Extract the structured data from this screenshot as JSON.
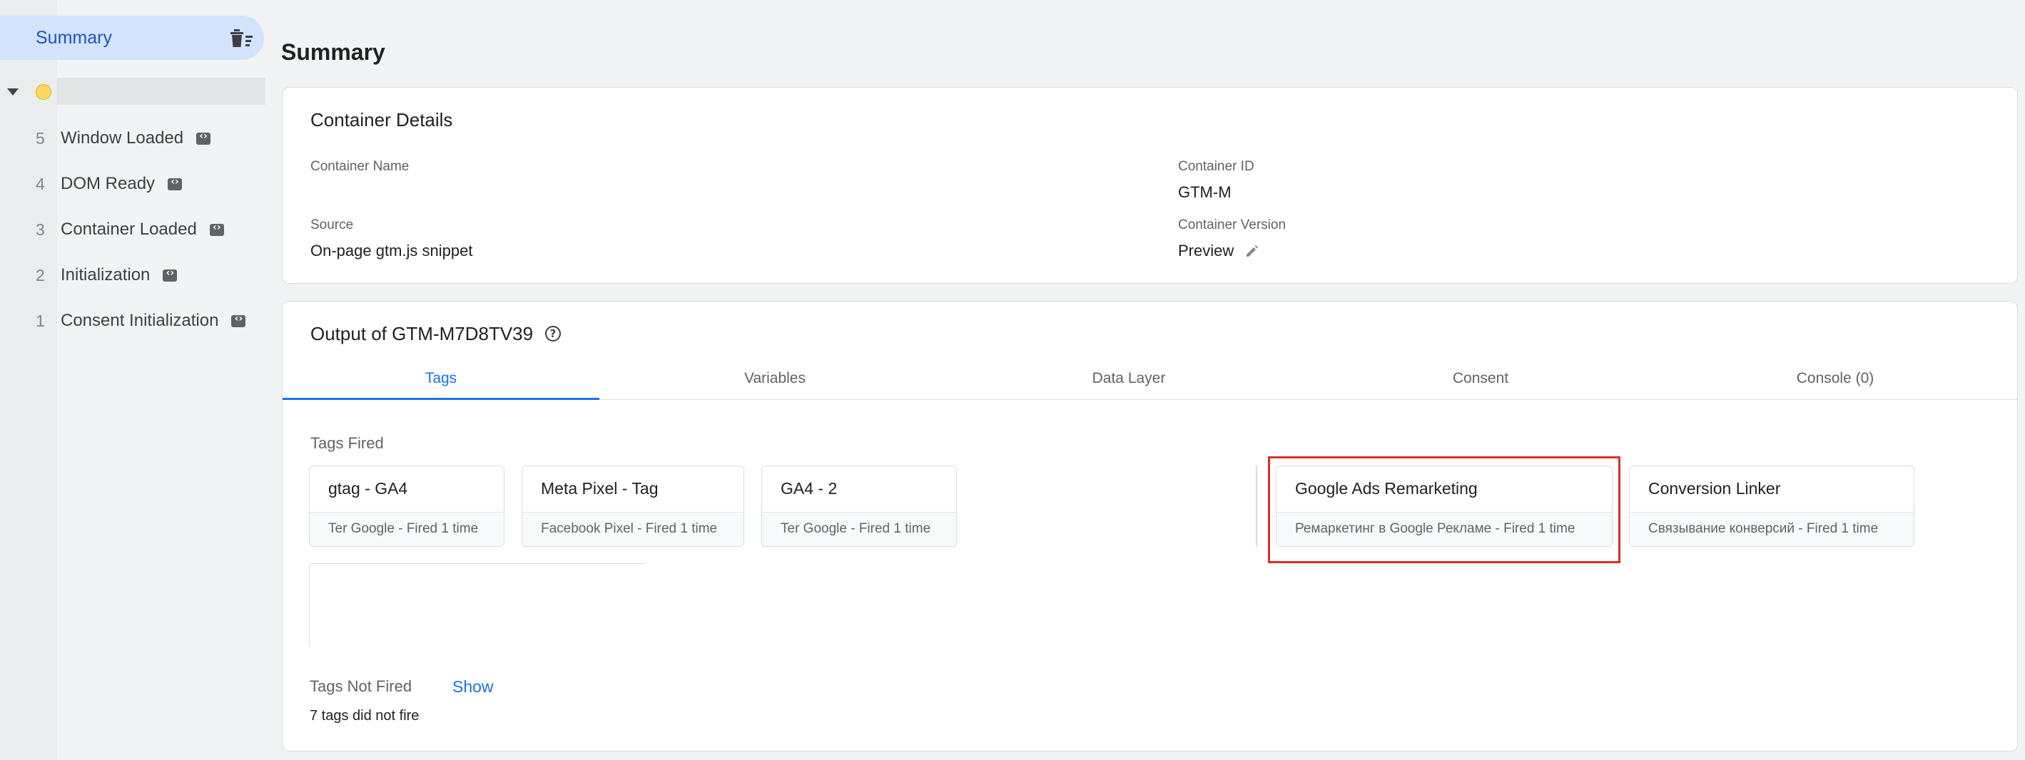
{
  "sidebar": {
    "summary_label": "Summary",
    "events": [
      {
        "num": "5",
        "label": "Window Loaded"
      },
      {
        "num": "4",
        "label": "DOM Ready"
      },
      {
        "num": "3",
        "label": "Container Loaded"
      },
      {
        "num": "2",
        "label": "Initialization"
      },
      {
        "num": "1",
        "label": "Consent Initialization"
      }
    ]
  },
  "main": {
    "title": "Summary",
    "container_details": {
      "title": "Container Details",
      "container_name_label": "Container Name",
      "container_name_value": "",
      "container_id_label": "Container ID",
      "container_id_value": "GTM-M",
      "source_label": "Source",
      "source_value": "On-page gtm.js snippet",
      "version_label": "Container Version",
      "version_value": "Preview"
    },
    "output": {
      "title": "Output of GTM-M7D8TV39",
      "tabs": [
        "Tags",
        "Variables",
        "Data Layer",
        "Consent",
        "Console (0)"
      ],
      "active_tab": "Tags",
      "tags_fired_label": "Tags Fired",
      "tags_fired": [
        {
          "name": "gtag - GA4",
          "meta": "Ter Google - Fired 1 time"
        },
        {
          "name": "Meta Pixel - Tag",
          "meta": "Facebook Pixel - Fired 1 time"
        },
        {
          "name": "GA4 - 2",
          "meta": "Ter Google - Fired 1 time"
        },
        {
          "name": "Google Ads Remarketing",
          "meta": "Ремаркетинг в Google Рекламе - Fired 1 time"
        },
        {
          "name": "Conversion Linker",
          "meta": "Связывание конверсий - Fired 1 time"
        }
      ],
      "tags_not_fired_label": "Tags Not Fired",
      "show_label": "Show",
      "not_fired_count_text": "7 tags did not fire"
    }
  },
  "colors": {
    "accent": "#1a73e8",
    "highlight": "#d93025",
    "status_dot": "#fdd663"
  },
  "icons": [
    "trash-icon",
    "code-icon",
    "pencil-icon",
    "help-icon",
    "caret-down-icon",
    "status-dot-icon"
  ]
}
